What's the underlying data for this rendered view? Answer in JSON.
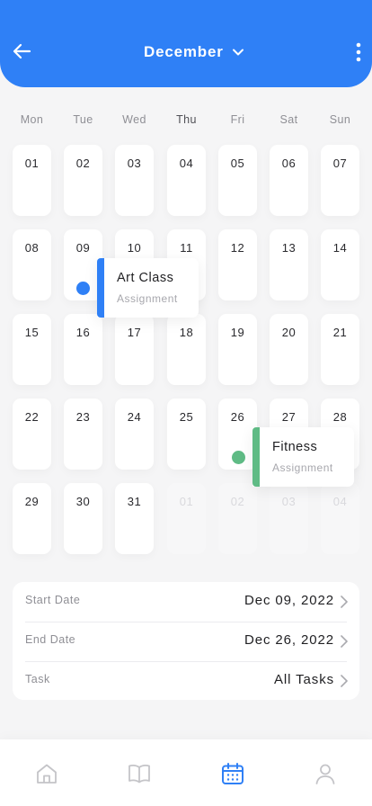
{
  "header": {
    "month_label": "December"
  },
  "weekdays": [
    "Mon",
    "Tue",
    "Wed",
    "Thu",
    "Fri",
    "Sat",
    "Sun"
  ],
  "days": [
    "01",
    "02",
    "03",
    "04",
    "05",
    "06",
    "07",
    "08",
    "09",
    "10",
    "11",
    "12",
    "13",
    "14",
    "15",
    "16",
    "17",
    "18",
    "19",
    "20",
    "21",
    "22",
    "23",
    "24",
    "25",
    "26",
    "27",
    "28",
    "29",
    "30",
    "31",
    "01",
    "02",
    "03",
    "04"
  ],
  "events": [
    {
      "title": "Art Class",
      "subtitle": "Assignment",
      "color": "#2f80f6"
    },
    {
      "title": "Fitness",
      "subtitle": "Assignment",
      "color": "#5fbb85"
    }
  ],
  "summary": {
    "start_label": "Start Date",
    "start_value": "Dec 09, 2022",
    "end_label": "End Date",
    "end_value": "Dec 26, 2022",
    "task_label": "Task",
    "task_value": "All Tasks"
  },
  "nav": {
    "items": [
      "home-icon",
      "book-icon",
      "calendar-icon",
      "profile-icon"
    ],
    "active": "calendar-icon"
  },
  "colors": {
    "primary": "#2f80f6",
    "fitness": "#5fbb85",
    "inactive_icon": "#c4c4c8"
  }
}
